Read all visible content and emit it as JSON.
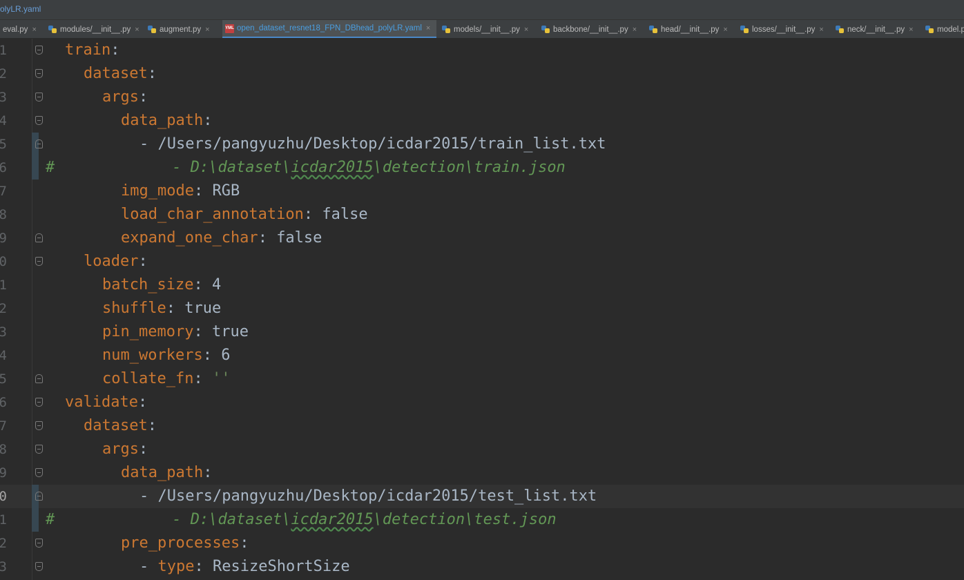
{
  "window": {
    "title_fragment": "olyLR.yaml"
  },
  "tabs": [
    {
      "label": "eval.py",
      "icon": "python-file-icon",
      "active": false
    },
    {
      "label": "modules/__init__.py",
      "icon": "python-file-icon",
      "active": false
    },
    {
      "label": "augment.py",
      "icon": "python-file-icon",
      "active": false
    },
    {
      "label": "open_dataset_resnet18_FPN_DBhead_polyLR.yaml",
      "icon": "yaml-file-icon",
      "active": true
    },
    {
      "label": "models/__init__.py",
      "icon": "python-file-icon",
      "active": false
    },
    {
      "label": "backbone/__init__.py",
      "icon": "python-file-icon",
      "active": false
    },
    {
      "label": "head/__init__.py",
      "icon": "python-file-icon",
      "active": false
    },
    {
      "label": "losses/__init__.py",
      "icon": "python-file-icon",
      "active": false
    },
    {
      "label": "neck/__init__.py",
      "icon": "python-file-icon",
      "active": false
    },
    {
      "label": "model.p",
      "icon": "python-file-icon",
      "active": false
    }
  ],
  "tab_close_glyph": "×",
  "yaml_badge": "YML",
  "colors": {
    "keyword": "#cc7832",
    "plain": "#a9b7c6",
    "string": "#6a8759",
    "comment": "#629755",
    "active_tab_accent": "#4a88c7",
    "background": "#2b2b2b"
  },
  "editor": {
    "current_line_number": "0",
    "lines": [
      {
        "num": "1",
        "key": "train",
        "sep": ":",
        "value": ""
      },
      {
        "num": "2",
        "key": "dataset",
        "sep": ":",
        "value": ""
      },
      {
        "num": "3",
        "key": "args",
        "sep": ":",
        "value": ""
      },
      {
        "num": "4",
        "key": "data_path",
        "sep": ":",
        "value": ""
      },
      {
        "num": "5",
        "dash": "- ",
        "value": "/Users/pangyuzhu/Desktop/icdar2015/train_list.txt"
      },
      {
        "num": "6",
        "hash": "#",
        "comment_pre": "- D:\\dataset\\",
        "comment_squig": "icdar2015",
        "comment_post": "\\detection\\train.json"
      },
      {
        "num": "7",
        "key": "img_mode",
        "sep": ": ",
        "value": "RGB"
      },
      {
        "num": "8",
        "key": "load_char_annotation",
        "sep": ": ",
        "value": "false"
      },
      {
        "num": "9",
        "key": "expand_one_char",
        "sep": ": ",
        "value": "false"
      },
      {
        "num": "0",
        "key": "loader",
        "sep": ":",
        "value": ""
      },
      {
        "num": "1",
        "key": "batch_size",
        "sep": ": ",
        "value": "4"
      },
      {
        "num": "2",
        "key": "shuffle",
        "sep": ": ",
        "value": "true"
      },
      {
        "num": "3",
        "key": "pin_memory",
        "sep": ": ",
        "value": "true"
      },
      {
        "num": "4",
        "key": "num_workers",
        "sep": ": ",
        "value": "6"
      },
      {
        "num": "5",
        "key": "collate_fn",
        "sep": ": ",
        "string": "''"
      },
      {
        "num": "6",
        "key": "validate",
        "sep": ":",
        "value": ""
      },
      {
        "num": "7",
        "key": "dataset",
        "sep": ":",
        "value": ""
      },
      {
        "num": "8",
        "key": "args",
        "sep": ":",
        "value": ""
      },
      {
        "num": "9",
        "key": "data_path",
        "sep": ":",
        "value": ""
      },
      {
        "num": "0",
        "dash": "- ",
        "value": "/Users/pangyuzhu/Desktop/icdar2015/test_list.txt"
      },
      {
        "num": "1",
        "hash": "#",
        "comment_pre": "- D:\\dataset\\",
        "comment_squig": "icdar2015",
        "comment_post": "\\detection\\test.json"
      },
      {
        "num": "2",
        "key": "pre_processes",
        "sep": ":",
        "value": ""
      },
      {
        "num": "3",
        "dash": "- ",
        "key": "type",
        "sep": ": ",
        "value": "ResizeShortSize"
      }
    ]
  }
}
